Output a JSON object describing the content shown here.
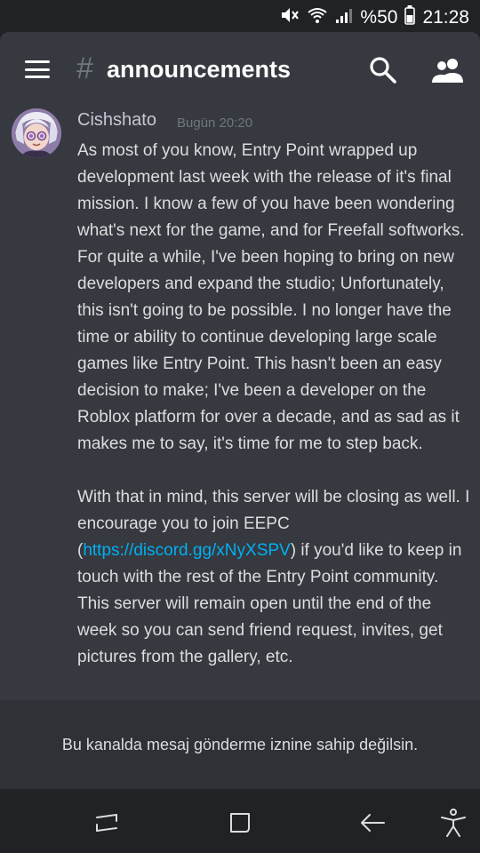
{
  "status_bar": {
    "battery_text": "%50",
    "time": "21:28",
    "icons": [
      "mute-icon",
      "wifi-icon",
      "signal-icon",
      "battery-icon"
    ]
  },
  "header": {
    "channel_prefix": "#",
    "channel_name": "announcements",
    "icons": [
      "menu-icon",
      "search-icon",
      "members-icon"
    ]
  },
  "message": {
    "author": "Cishshato",
    "timestamp": "Bugün 20:20",
    "paragraph1": "As most of you know, Entry Point wrapped up development last week with the release of it's final mission. I know a few of you have been wondering what's next for the game, and for Freefall softworks. For quite a while, I've been hoping to bring on new developers and expand the studio; Unfortunately, this isn't going to be possible. I no longer have the time or ability to continue developing large scale games like Entry Point. This hasn't been an easy decision to make; I've been a developer on the Roblox platform for over a decade, and as sad as it makes me to say, it's time for me to step back.",
    "paragraph2_before_link": "With that in mind, this server will be closing as well. I encourage you to join EEPC (",
    "link_text": "https://discord.gg/xNyXSPV",
    "paragraph2_after_link": ") if you'd like to keep in touch with the rest of the Entry Point community. This server will remain open until the end of the week so you can send friend request, invites, get pictures from the gallery, etc."
  },
  "notice": {
    "text": "Bu kanalda mesaj gönderme iznine sahip değilsin."
  },
  "nav_bar": {
    "icons": [
      "recents-icon",
      "home-icon",
      "back-icon",
      "accessibility-icon"
    ]
  },
  "colors": {
    "background": "#202225",
    "panel": "#36393f",
    "notice_bg": "#2f3136",
    "link": "#00b0f4",
    "muted": "#72767d"
  }
}
